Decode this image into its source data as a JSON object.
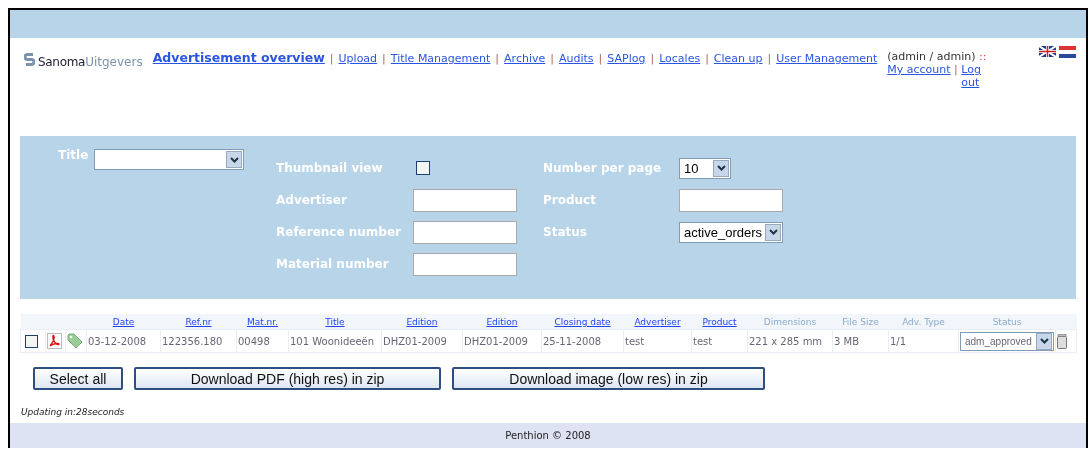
{
  "logo": {
    "brand": "Sanoma",
    "sub": "Uitgevers"
  },
  "nav": [
    {
      "label": "Advertisement overview",
      "selected": true
    },
    {
      "label": "Upload",
      "selected": false
    },
    {
      "label": "Title Management",
      "selected": false
    },
    {
      "label": "Archive",
      "selected": false
    },
    {
      "label": "Audits",
      "selected": false
    },
    {
      "label": "SAPlog",
      "selected": false
    },
    {
      "label": "Locales",
      "selected": false
    },
    {
      "label": "Clean up",
      "selected": false
    },
    {
      "label": "User Management",
      "selected": false
    }
  ],
  "nav_separator": "|",
  "user": {
    "name": "(admin / admin)",
    "marker": "::",
    "links": [
      "My account",
      "Log out"
    ],
    "separator": "|"
  },
  "filters": [
    {
      "kind": "dropdown",
      "label": "Title"
    },
    {
      "kind": "checkbox",
      "label": "Thumbnail view",
      "checked": false
    },
    {
      "kind": "dropdown",
      "label": "Number per page",
      "value": "10"
    },
    {
      "kind": "text",
      "label": "Advertiser"
    },
    {
      "kind": "text",
      "label": "Product"
    },
    {
      "kind": "text",
      "label": "Reference number"
    },
    {
      "kind": "dropdown",
      "label": "Status",
      "value": "active_orders"
    },
    {
      "kind": "text",
      "label": "Material number"
    }
  ],
  "table": {
    "columns": [
      {
        "label": "Date",
        "sortable": true
      },
      {
        "label": "Ref.nr",
        "sortable": true
      },
      {
        "label": "Mat.nr.",
        "sortable": true
      },
      {
        "label": "Title",
        "sortable": true
      },
      {
        "label": "Edition",
        "sortable": true
      },
      {
        "label": "Edition",
        "sortable": true
      },
      {
        "label": "Closing date",
        "sortable": true
      },
      {
        "label": "Advertiser",
        "sortable": true
      },
      {
        "label": "Product",
        "sortable": true
      },
      {
        "label": "Dimensions",
        "sortable": false
      },
      {
        "label": "File Size",
        "sortable": false
      },
      {
        "label": "Adv. Type",
        "sortable": false
      },
      {
        "label": "Status",
        "sortable": false
      }
    ],
    "rows": [
      {
        "checked": false,
        "cells": [
          "03-12-2008",
          "122356.180",
          "00498",
          "101 Woonideeën",
          "DHZ01-2009",
          "DHZ01-2009",
          "25-11-2008",
          "test",
          "test",
          "221 x 285 mm",
          "3 MB",
          "1/1"
        ],
        "status": "adm_approved"
      }
    ]
  },
  "buttons": [
    "Select all",
    "Download PDF (high res) in zip",
    "Download image (low res) in zip"
  ],
  "updating": "Updating in:28seconds",
  "footer": "Penthion © 2008"
}
